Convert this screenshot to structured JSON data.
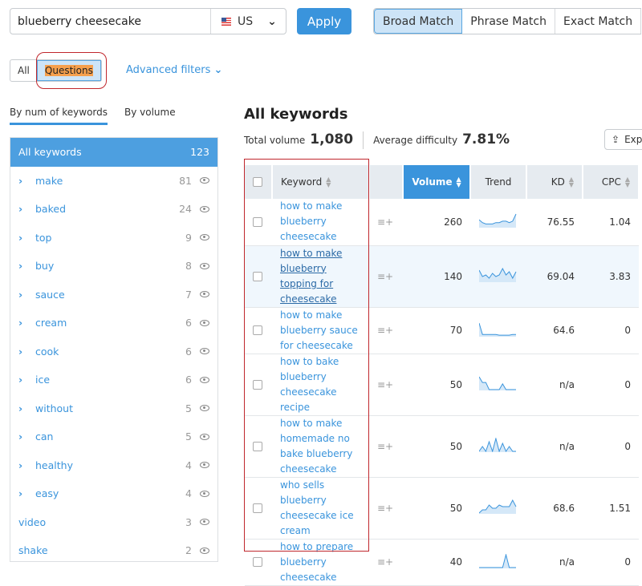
{
  "search": {
    "query": "blueberry cheesecake",
    "database": "US",
    "apply": "Apply"
  },
  "match_types": [
    "Broad Match",
    "Phrase Match",
    "Exact Match"
  ],
  "filters": {
    "all": "All",
    "questions": "Questions",
    "advanced": "Advanced filters"
  },
  "group_tabs": [
    "By num of keywords",
    "By volume"
  ],
  "groups": [
    {
      "label": "All keywords",
      "count": "123",
      "active": true
    },
    {
      "label": "make",
      "count": "81",
      "expand": true
    },
    {
      "label": "baked",
      "count": "24",
      "expand": true
    },
    {
      "label": "top",
      "count": "9",
      "expand": true
    },
    {
      "label": "buy",
      "count": "8",
      "expand": true
    },
    {
      "label": "sauce",
      "count": "7",
      "expand": true
    },
    {
      "label": "cream",
      "count": "6",
      "expand": true
    },
    {
      "label": "cook",
      "count": "6",
      "expand": true
    },
    {
      "label": "ice",
      "count": "6",
      "expand": true
    },
    {
      "label": "without",
      "count": "5",
      "expand": true
    },
    {
      "label": "can",
      "count": "5",
      "expand": true
    },
    {
      "label": "healthy",
      "count": "4",
      "expand": true
    },
    {
      "label": "easy",
      "count": "4",
      "expand": true
    },
    {
      "label": "video",
      "count": "3"
    },
    {
      "label": "shake",
      "count": "2"
    }
  ],
  "main": {
    "title": "All keywords",
    "total_volume_label": "Total volume",
    "total_volume": "1,080",
    "avg_difficulty_label": "Average difficulty",
    "avg_difficulty": "7.81%",
    "export": "Exp"
  },
  "table": {
    "columns": [
      "Keyword",
      "Volume",
      "Trend",
      "KD",
      "CPC"
    ],
    "rows": [
      {
        "keyword": "how to make blueberry cheesecake",
        "volume": "260",
        "kd": "76.55",
        "cpc": "1.04",
        "trend": [
          5,
          3,
          2,
          2,
          2,
          3,
          3,
          4,
          4,
          3,
          4,
          9
        ]
      },
      {
        "keyword": "how to make blueberry topping for cheesecake",
        "volume": "140",
        "kd": "69.04",
        "cpc": "3.83",
        "trend": [
          7,
          3,
          4,
          2,
          5,
          3,
          4,
          8,
          4,
          6,
          2,
          6
        ],
        "highlight": true
      },
      {
        "keyword": "how to make blueberry sauce for cheesecake",
        "volume": "70",
        "kd": "64.6",
        "cpc": "0",
        "trend": [
          9,
          1,
          1,
          1,
          1,
          1,
          0.5,
          0.5,
          0.5,
          0.5,
          1,
          1
        ]
      },
      {
        "keyword": "how to bake blueberry cheesecake recipe",
        "volume": "50",
        "kd": "n/a",
        "cpc": "0",
        "trend": [
          9,
          5,
          5,
          0,
          0,
          0,
          0,
          4,
          0,
          0,
          0,
          0
        ]
      },
      {
        "keyword": "how to make homemade no bake blueberry cheesecake",
        "volume": "50",
        "kd": "n/a",
        "cpc": "0",
        "trend": [
          0,
          3,
          0,
          6,
          0,
          8,
          0,
          5,
          0,
          3,
          0,
          0
        ]
      },
      {
        "keyword": "who sells blueberry cheesecake ice cream",
        "volume": "50",
        "kd": "68.6",
        "cpc": "1.51",
        "trend": [
          0,
          2,
          2,
          5,
          3,
          3,
          5,
          4,
          4,
          4,
          8,
          4
        ]
      },
      {
        "keyword": "how to prepare blueberry cheesecake",
        "volume": "40",
        "kd": "n/a",
        "cpc": "0",
        "trend": [
          0,
          0,
          0,
          0,
          0,
          0,
          0,
          0,
          9,
          0,
          0,
          0
        ]
      }
    ]
  },
  "colors": {
    "accent": "#3a94dc",
    "highlight_ring": "#c0272d",
    "questions_highlight": "#f6a04d"
  }
}
